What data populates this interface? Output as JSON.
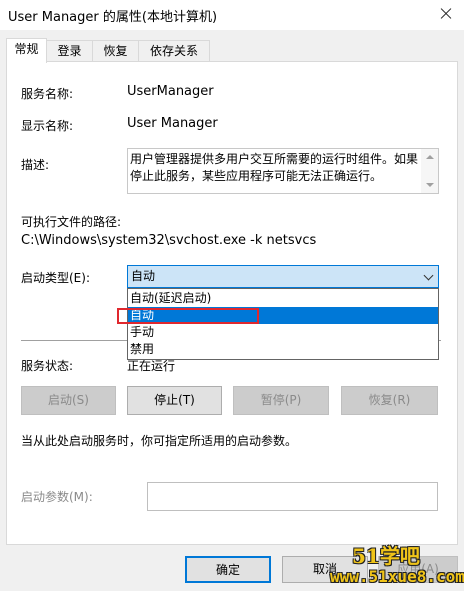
{
  "window": {
    "title": "User Manager 的属性(本地计算机)"
  },
  "tabs": [
    {
      "label": "常规",
      "active": true
    },
    {
      "label": "登录",
      "active": false
    },
    {
      "label": "恢复",
      "active": false
    },
    {
      "label": "依存关系",
      "active": false
    }
  ],
  "general": {
    "service_name_label": "服务名称:",
    "service_name_value": "UserManager",
    "display_name_label": "显示名称:",
    "display_name_value": "User Manager",
    "description_label": "描述:",
    "description_value": "用户管理器提供多用户交互所需要的运行时组件。如果停止此服务，某些应用程序可能无法正确运行。",
    "exe_path_label": "可执行文件的路径:",
    "exe_path_value": "C:\\Windows\\system32\\svchost.exe -k netsvcs",
    "startup_type_label": "启动类型(E):",
    "startup_type_value": "自动",
    "startup_options": [
      "自动(延迟启动)",
      "自动",
      "手动",
      "禁用"
    ],
    "startup_selected_index": 1,
    "status_label": "服务状态:",
    "status_value": "正在运行",
    "buttons": {
      "start": "启动(S)",
      "stop": "停止(T)",
      "pause": "暂停(P)",
      "resume": "恢复(R)"
    },
    "hint_text": "当从此处启动服务时，你可指定所适用的启动参数。",
    "params_label": "启动参数(M):",
    "params_value": ""
  },
  "footer": {
    "ok": "确定",
    "cancel": "取消",
    "apply": "应用(A)"
  },
  "watermark": {
    "top": "51学吧",
    "url": "www.51xue8.com"
  },
  "colors": {
    "accent": "#0078d7",
    "highlight_box": "#e0282e",
    "watermark": "#f0c419"
  }
}
